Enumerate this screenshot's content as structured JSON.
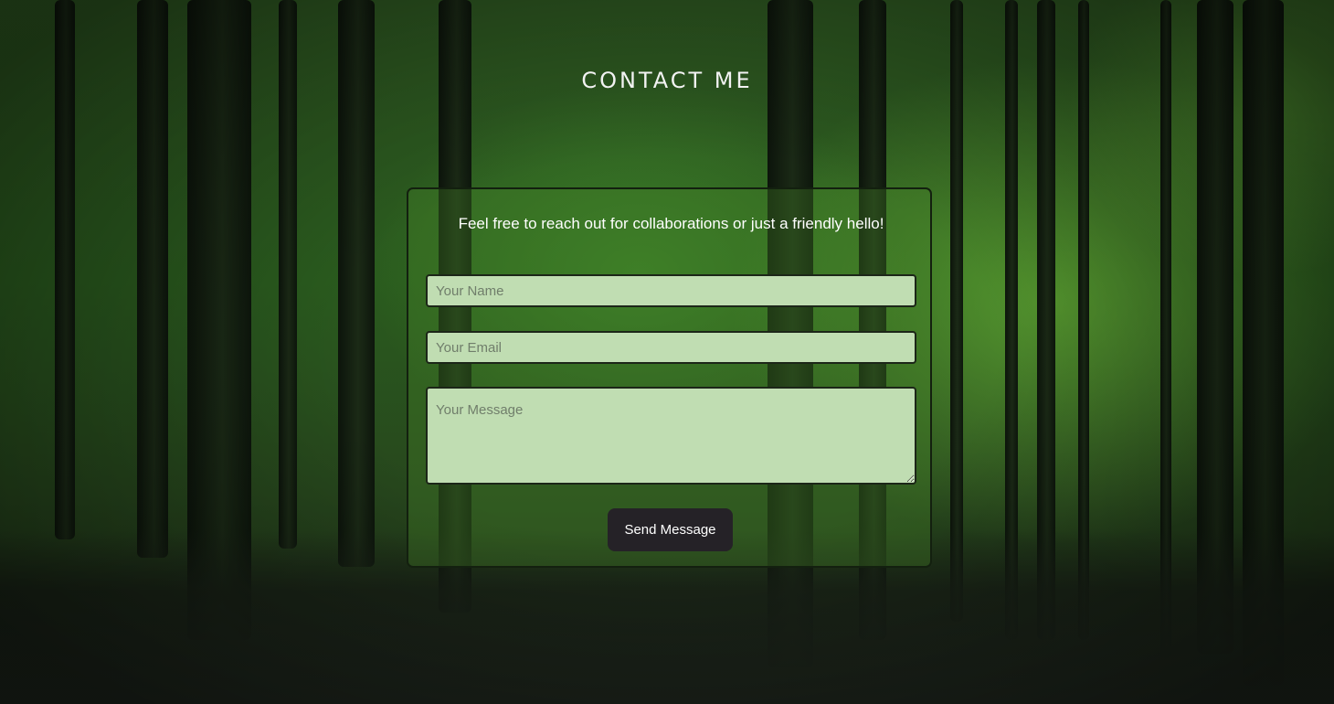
{
  "page": {
    "title": "CONTACT ME"
  },
  "contact_form": {
    "intro": "Feel free to reach out for collaborations or just a friendly hello!",
    "name_placeholder": "Your Name",
    "email_placeholder": "Your Email",
    "message_placeholder": "Your Message",
    "send_label": "Send Message"
  },
  "colors": {
    "field_background": "#c0ddb2",
    "button_background": "#252227",
    "title_text": "#f2f2f2"
  }
}
